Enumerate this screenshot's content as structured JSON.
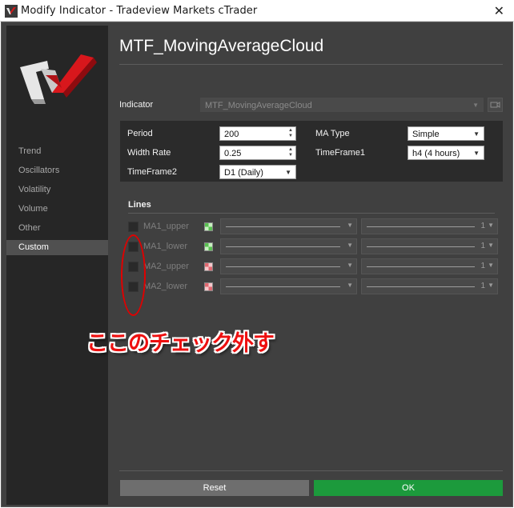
{
  "window": {
    "title": "Modify Indicator - Tradeview Markets cTrader",
    "close_glyph": "✕"
  },
  "sidebar": {
    "items": [
      {
        "label": "Trend",
        "active": false
      },
      {
        "label": "Oscillators",
        "active": false
      },
      {
        "label": "Volatility",
        "active": false
      },
      {
        "label": "Volume",
        "active": false
      },
      {
        "label": "Other",
        "active": false
      },
      {
        "label": "Custom",
        "active": true
      }
    ]
  },
  "main": {
    "title": "MTF_MovingAverageCloud",
    "indicator": {
      "label": "Indicator",
      "value": "MTF_MovingAverageCloud"
    },
    "params": {
      "period": {
        "label": "Period",
        "value": "200"
      },
      "ma_type": {
        "label": "MA Type",
        "value": "Simple"
      },
      "width_rate": {
        "label": "Width Rate",
        "value": "0.25"
      },
      "timeframe1": {
        "label": "TimeFrame1",
        "value": "h4 (4 hours)"
      },
      "timeframe2": {
        "label": "TimeFrame2",
        "value": "D1 (Daily)"
      }
    },
    "lines": {
      "title": "Lines",
      "items": [
        {
          "name": "MA1_upper",
          "checked": false,
          "swatch": "green",
          "thickness": "1"
        },
        {
          "name": "MA1_lower",
          "checked": false,
          "swatch": "green",
          "thickness": "1"
        },
        {
          "name": "MA2_upper",
          "checked": false,
          "swatch": "red",
          "thickness": "1"
        },
        {
          "name": "MA2_lower",
          "checked": false,
          "swatch": "red",
          "thickness": "1"
        }
      ]
    }
  },
  "footer": {
    "reset_label": "Reset",
    "ok_label": "OK"
  },
  "annotation": {
    "text": "ここのチェック外す",
    "color": "#ee1010"
  },
  "colors": {
    "background": "#404040",
    "sidebar": "#262626",
    "ok": "#1c9a3c",
    "reset": "#6e6e6e"
  },
  "icons": {
    "app": "ctrader-logo-icon",
    "dropdown": "chevron-down-icon",
    "camera": "camera-icon"
  }
}
